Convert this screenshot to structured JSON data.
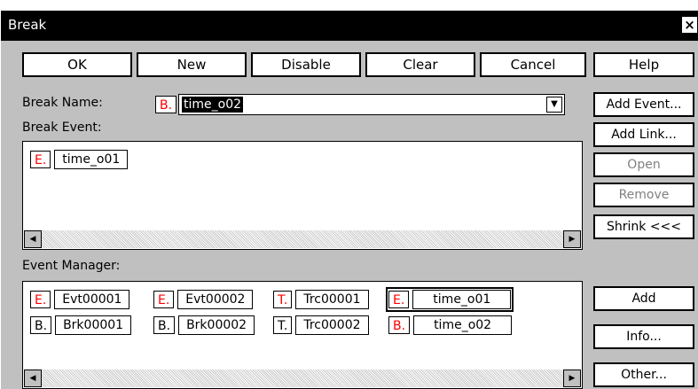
{
  "window": {
    "title": "Break",
    "close_glyph": "×"
  },
  "toolbar": {
    "ok": "OK",
    "new": "New",
    "disable": "Disable",
    "clear": "Clear",
    "cancel": "Cancel",
    "help": "Help"
  },
  "break_name": {
    "label": "Break Name:",
    "badge": "B.",
    "value": "time_o02",
    "dropdown_glyph": "▼"
  },
  "break_event": {
    "label": "Break Event:",
    "items": [
      {
        "badge": "E.",
        "name": "time_o01"
      }
    ]
  },
  "side_buttons": {
    "add_event": "Add Event...",
    "add_link": "Add Link...",
    "open": "Open",
    "remove": "Remove",
    "shrink": "Shrink <<<"
  },
  "event_manager": {
    "label": "Event Manager:",
    "row1": [
      {
        "badge": "E.",
        "name": "Evt00001"
      },
      {
        "badge": "E.",
        "name": "Evt00002"
      },
      {
        "badge": "T.",
        "name": "Trc00001"
      },
      {
        "badge": "E.",
        "name": "time_o01"
      }
    ],
    "row2": [
      {
        "badge": "B.",
        "name": "Brk00001"
      },
      {
        "badge": "B.",
        "name": "Brk00002"
      },
      {
        "badge": "T.",
        "name": "Trc00002"
      },
      {
        "badge": "B.",
        "name": "time_o02"
      }
    ]
  },
  "manager_buttons": {
    "add": "Add",
    "info": "Info...",
    "other": "Other..."
  },
  "scroll": {
    "left_glyph": "◀",
    "right_glyph": "▶"
  },
  "colors": {
    "badge_red": "#ff0000",
    "dialog_bg": "#c0c0c0",
    "titlebar": "#000000"
  }
}
